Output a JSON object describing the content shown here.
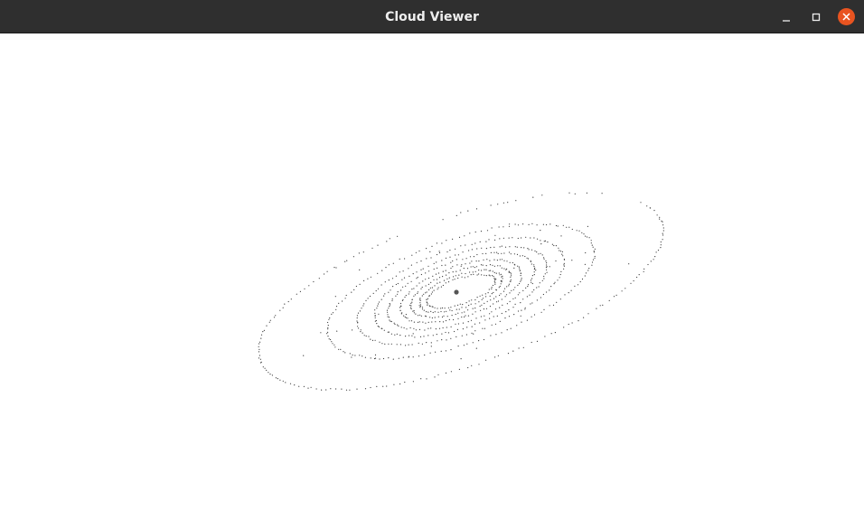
{
  "window": {
    "title": "Cloud Viewer"
  },
  "titlebar_buttons": {
    "minimize_icon": "minimize-icon",
    "maximize_icon": "maximize-icon",
    "close_icon": "close-icon",
    "close_color": "#e95420"
  },
  "viewport": {
    "background": "#ffffff",
    "point_color": "#3a3a3a"
  }
}
